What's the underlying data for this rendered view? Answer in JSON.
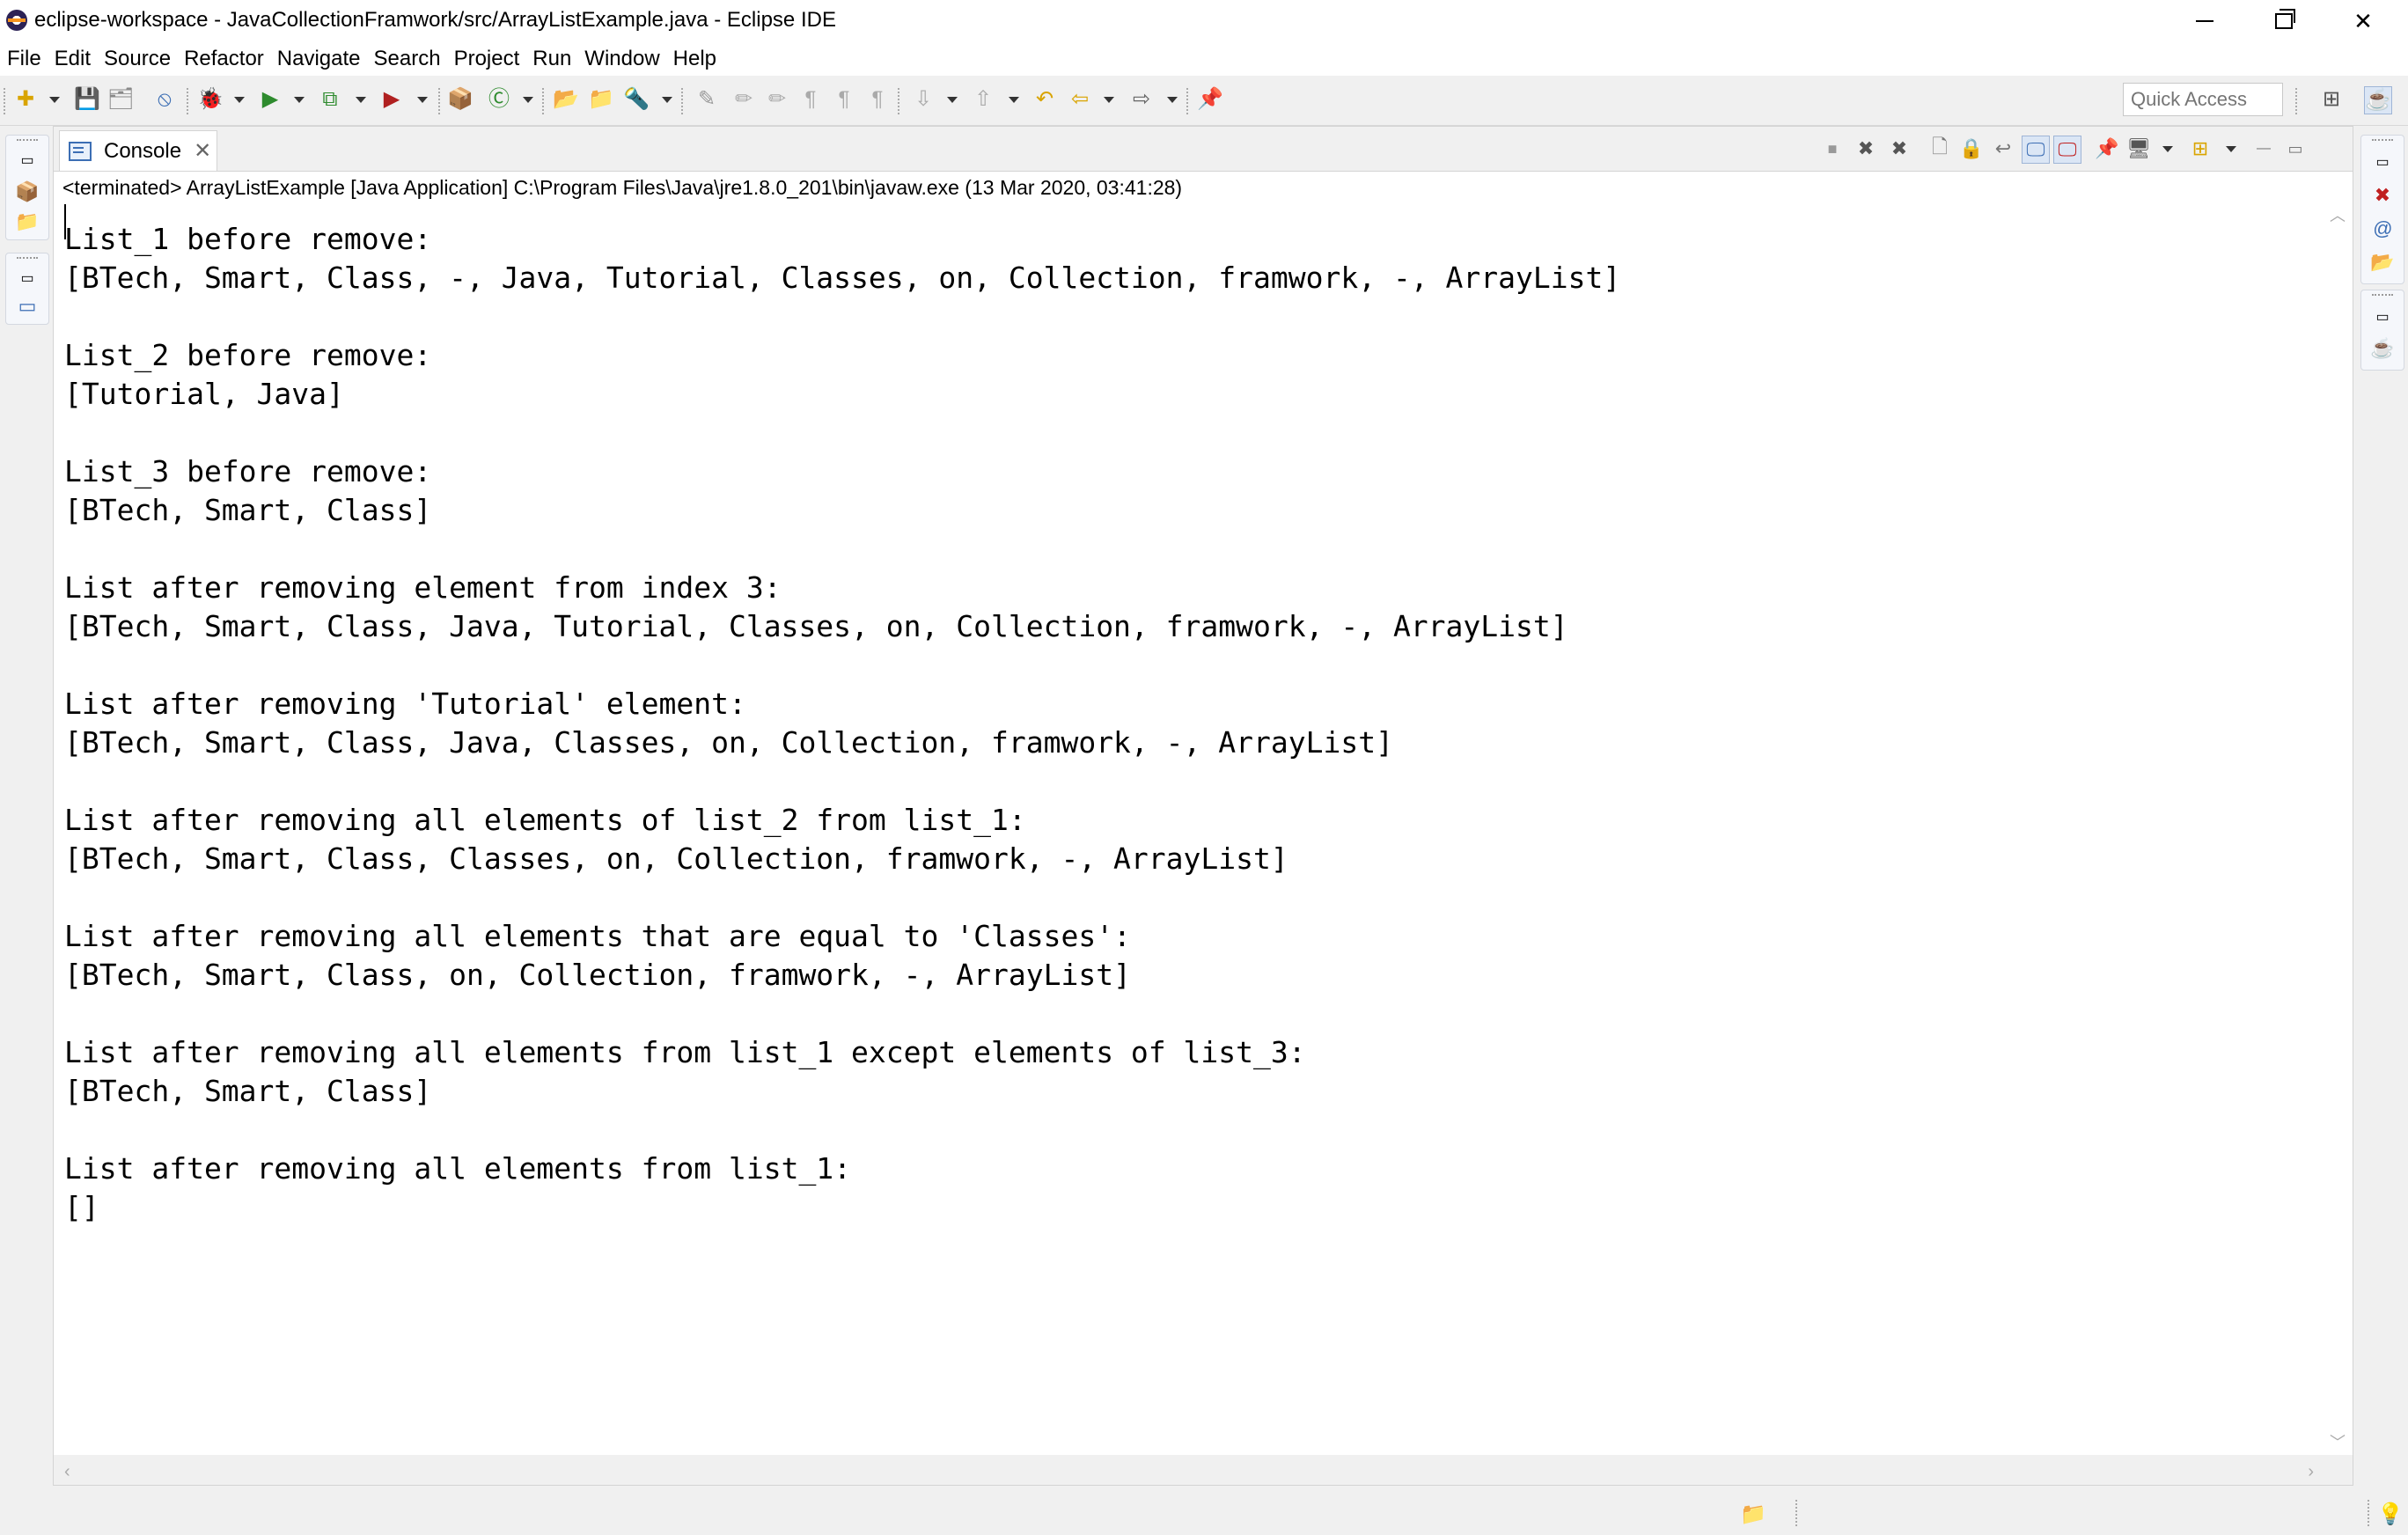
{
  "window": {
    "title": "eclipse-workspace - JavaCollectionFramwork/src/ArrayListExample.java - Eclipse IDE",
    "min_glyph": "",
    "close_glyph": "✕"
  },
  "menu": [
    "File",
    "Edit",
    "Source",
    "Refactor",
    "Navigate",
    "Search",
    "Project",
    "Run",
    "Window",
    "Help"
  ],
  "toolbar": {
    "quick_access_placeholder": "Quick Access",
    "icons": {
      "new": "✚",
      "save": "💾",
      "save_all": "🗂",
      "skip_breakpoints": "⦸",
      "debug": "🐞",
      "run": "▶",
      "coverage": "⧉",
      "external_tools": "▶",
      "new_package": "📦",
      "new_class": "Ⓒ",
      "open_type": "📂",
      "open_task": "📁",
      "search": "🔦",
      "toggle_annotation": "✎",
      "highlight": "✏",
      "word_wrap": "¶",
      "next_annotation": "⇩",
      "prev_annotation": "⇧",
      "last_edit": "↶",
      "back": "⇦",
      "forward": "⇨",
      "pin": "📌",
      "perspective_open": "⊞",
      "perspective_java": "☕"
    }
  },
  "console": {
    "tab_label": "Console",
    "tab_close": "✕",
    "status": "<terminated> ArrayListExample [Java Application] C:\\Program Files\\Java\\jre1.8.0_201\\bin\\javaw.exe (13 Mar 2020, 03:41:28)",
    "lines": [
      "List_1 before remove:",
      "[BTech, Smart, Class, -, Java, Tutorial, Classes, on, Collection, framwork, -, ArrayList]",
      "",
      "List_2 before remove:",
      "[Tutorial, Java]",
      "",
      "List_3 before remove:",
      "[BTech, Smart, Class]",
      "",
      "List after removing element from index 3:",
      "[BTech, Smart, Class, Java, Tutorial, Classes, on, Collection, framwork, -, ArrayList]",
      "",
      "List after removing 'Tutorial' element:",
      "[BTech, Smart, Class, Java, Classes, on, Collection, framwork, -, ArrayList]",
      "",
      "List after removing all elements of list_2 from list_1:",
      "[BTech, Smart, Class, Classes, on, Collection, framwork, -, ArrayList]",
      "",
      "List after removing all elements that are equal to 'Classes':",
      "[BTech, Smart, Class, on, Collection, framwork, -, ArrayList]",
      "",
      "List after removing all elements from list_1 except elements of list_3:",
      "[BTech, Smart, Class]",
      "",
      "List after removing all elements from list_1:",
      "[]"
    ],
    "view_icons": {
      "terminate": "■",
      "remove_launch": "✖",
      "remove_all": "✖",
      "clear": "🗋",
      "scroll_lock": "🔒",
      "word_wrap": "↩",
      "show_on_stdout": "🖵",
      "show_on_stderr": "🖵",
      "pin": "📌",
      "display_selected": "🖥",
      "open_console": "⊞",
      "minimize": "—",
      "maximize": "▭"
    }
  },
  "colors": {
    "accent": "#3c6eb4",
    "run_green": "#2e8b2e",
    "background": "#f0f0f0",
    "view_bg": "#ffffff"
  }
}
